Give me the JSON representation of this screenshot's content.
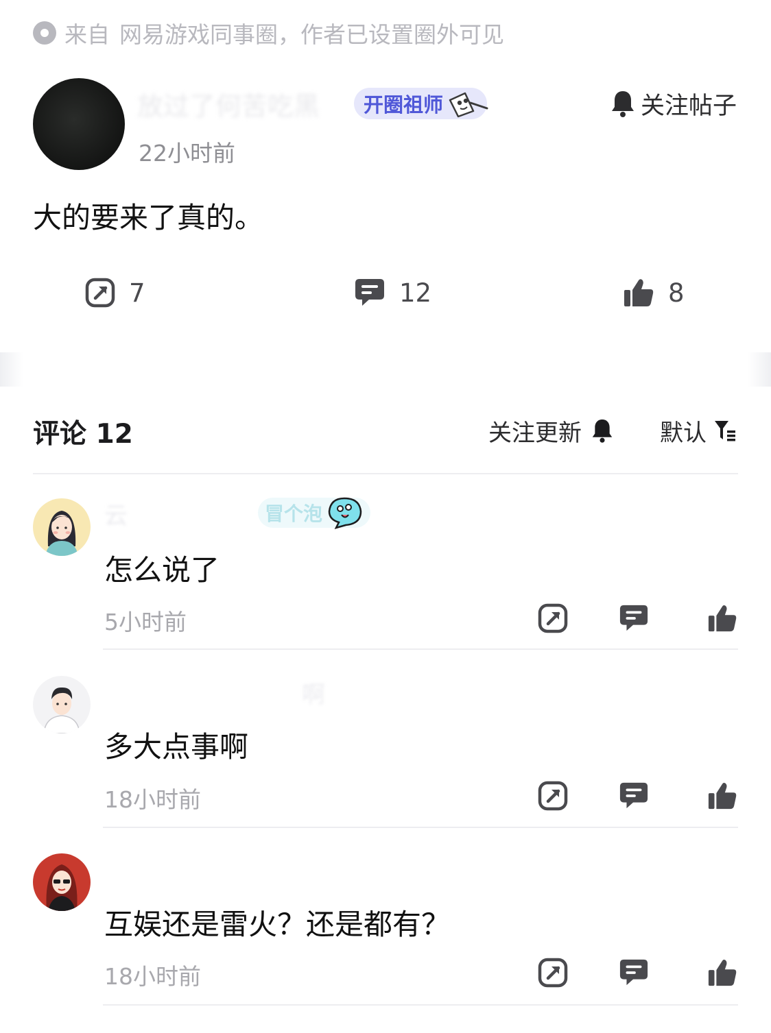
{
  "source": {
    "prefix": "来自",
    "community": "网易游戏同事圈，作者已设置圈外可见"
  },
  "post": {
    "author_name": "放过了何苦吃黑",
    "badge": "开圈祖师",
    "time": "22小时前",
    "follow_label": "关注帖子",
    "body": "大的要来了真的。",
    "share_count": "7",
    "comment_count": "12",
    "like_count": "8"
  },
  "comments_header": {
    "title": "评论 12",
    "follow_updates": "关注更新",
    "sort": "默认"
  },
  "comments": [
    {
      "name": "云",
      "bubble": "冒个泡",
      "text": "怎么说了",
      "time": "5小时前"
    },
    {
      "name": "啊",
      "text": "多大点事啊",
      "time": "18小时前"
    },
    {
      "name": "",
      "text": "互娱还是雷火？还是都有？",
      "time": "18小时前"
    }
  ],
  "icons": {
    "source": "circle-dot-icon",
    "bell": "bell-icon",
    "share": "share-icon",
    "comment": "comment-icon",
    "like": "thumbs-up-icon",
    "filter": "filter-icon"
  }
}
